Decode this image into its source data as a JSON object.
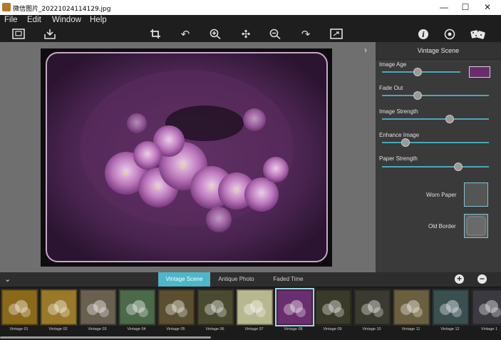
{
  "window": {
    "title": "微信图片_20221024114129.jpg",
    "min": "—",
    "max": "☐",
    "close": "✕"
  },
  "menu": [
    "File",
    "Edit",
    "Window",
    "Help"
  ],
  "panel": {
    "title": "Vintage Scene",
    "sliders": [
      {
        "label": "Image Age",
        "value": 0.45
      },
      {
        "label": "Fade Out",
        "value": 0.33
      },
      {
        "label": "Image Strength",
        "value": 0.63
      },
      {
        "label": "Enhance Image",
        "value": 0.22
      },
      {
        "label": "Paper Strength",
        "value": 0.71
      }
    ],
    "swatch_color": "#6a2e6f",
    "worn_paper_label": "Worn Paper",
    "old_border_label": "Old Border"
  },
  "tabs": [
    "Vintage Scene",
    "Antique Photo",
    "Faded Time"
  ],
  "active_tab": 0,
  "presets": [
    {
      "label": "Vintage 01",
      "color": "#8a6a1a"
    },
    {
      "label": "Vintage 02",
      "color": "#9a7a2a"
    },
    {
      "label": "Vintage 03",
      "color": "#6a6050"
    },
    {
      "label": "Vintage 04",
      "color": "#4a6a4a"
    },
    {
      "label": "Vintage 05",
      "color": "#5a5030"
    },
    {
      "label": "Vintage 06",
      "color": "#4a4a30"
    },
    {
      "label": "Vintage 07",
      "color": "#b8b890"
    },
    {
      "label": "Vintage 08",
      "color": "#6a2e6f"
    },
    {
      "label": "Vintage 09",
      "color": "#3a3a28"
    },
    {
      "label": "Vintage 10",
      "color": "#3a3a30"
    },
    {
      "label": "Vintage 11",
      "color": "#6a6040"
    },
    {
      "label": "Vintage 12",
      "color": "#3a5050"
    },
    {
      "label": "Vintage 1",
      "color": "#3a3a40"
    }
  ],
  "selected_preset": 7,
  "colors": {
    "accent": "#4cb7c9",
    "image_tint": "#6a2e6f"
  }
}
